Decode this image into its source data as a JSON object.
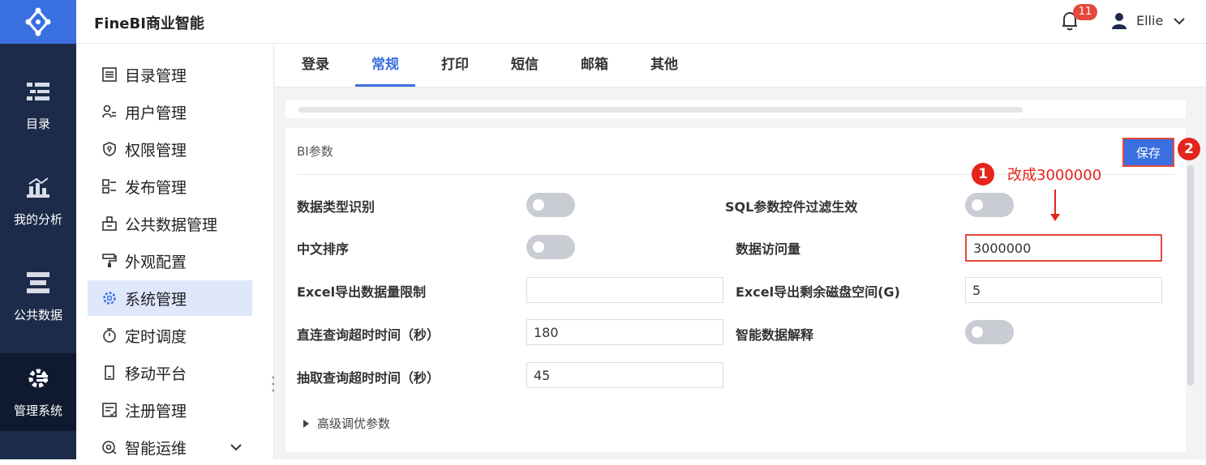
{
  "app": {
    "title": "FineBI商业智能"
  },
  "header": {
    "notification_count": "11",
    "user_name": "Ellie"
  },
  "rail": [
    {
      "label": "目录",
      "icon": "catalog-icon"
    },
    {
      "label": "我的分析",
      "icon": "analysis-chart-icon"
    },
    {
      "label": "公共数据",
      "icon": "public-data-icon"
    },
    {
      "label": "管理系统",
      "icon": "manage-system-icon"
    }
  ],
  "submenu": [
    {
      "label": "目录管理",
      "icon": "list-icon"
    },
    {
      "label": "用户管理",
      "icon": "user-list-icon"
    },
    {
      "label": "权限管理",
      "icon": "shield-icon"
    },
    {
      "label": "发布管理",
      "icon": "publish-icon"
    },
    {
      "label": "公共数据管理",
      "icon": "data-manage-icon"
    },
    {
      "label": "外观配置",
      "icon": "paint-roller-icon"
    },
    {
      "label": "系统管理",
      "icon": "gear-icon"
    },
    {
      "label": "定时调度",
      "icon": "stopwatch-icon"
    },
    {
      "label": "移动平台",
      "icon": "mobile-icon"
    },
    {
      "label": "注册管理",
      "icon": "register-icon"
    },
    {
      "label": "智能运维",
      "icon": "ops-icon"
    }
  ],
  "tabs": [
    "登录",
    "常规",
    "打印",
    "短信",
    "邮箱",
    "其他"
  ],
  "active_tab": "常规",
  "panel": {
    "title": "BI参数",
    "save_label": "保存",
    "fields": {
      "data_type_detect": {
        "label": "数据类型识别",
        "on": false
      },
      "chinese_sort": {
        "label": "中文排序",
        "on": false
      },
      "excel_export_limit": {
        "label": "Excel导出数据量限制",
        "value": ""
      },
      "direct_query_timeout": {
        "label": "直连查询超时时间（秒）",
        "value": "180"
      },
      "extract_query_timeout": {
        "label": "抽取查询超时时间（秒）",
        "value": "45"
      },
      "sql_param_filter": {
        "label": "SQL参数控件过滤生效",
        "on": false
      },
      "data_access_volume": {
        "label": "数据访问量",
        "value": "3000000"
      },
      "excel_disk_space": {
        "label": "Excel导出剩余磁盘空间(G)",
        "value": "5"
      },
      "smart_data_explain": {
        "label": "智能数据解释",
        "on": false
      }
    },
    "advanced_label": "高级调优参数"
  },
  "annotations": {
    "marker_1": "1",
    "marker_2": "2",
    "note": "改成3000000",
    "color": "#e5241b"
  },
  "colors": {
    "accent": "#3a6fe0",
    "rail": "#1c2b4a",
    "badge": "#e5483c"
  }
}
